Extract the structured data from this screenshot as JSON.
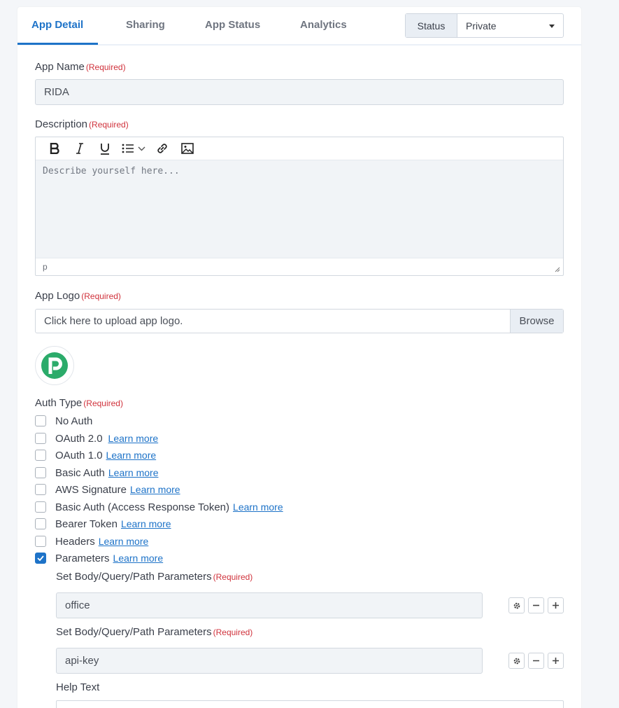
{
  "tabs": [
    {
      "label": "App Detail",
      "active": true
    },
    {
      "label": "Sharing",
      "active": false
    },
    {
      "label": "App Status",
      "active": false
    },
    {
      "label": "Analytics",
      "active": false
    }
  ],
  "status": {
    "label": "Status",
    "value": "Private"
  },
  "required_text": "(Required)",
  "app_name": {
    "label": "App Name",
    "value": "RIDA"
  },
  "description": {
    "label": "Description",
    "placeholder": "Describe yourself here...",
    "status_path": "p"
  },
  "app_logo": {
    "label": "App Logo",
    "placeholder": "Click here to upload app logo.",
    "browse_label": "Browse"
  },
  "auth_type": {
    "label": "Auth Type",
    "learn_more": "Learn more",
    "options": [
      {
        "label": "No Auth",
        "checked": false,
        "has_link": false
      },
      {
        "label": "OAuth 2.0",
        "checked": false,
        "has_link": true
      },
      {
        "label": "OAuth 1.0",
        "checked": false,
        "has_link": true
      },
      {
        "label": "Basic Auth",
        "checked": false,
        "has_link": true
      },
      {
        "label": "AWS Signature",
        "checked": false,
        "has_link": true
      },
      {
        "label": "Basic Auth (Access Response Token)",
        "checked": false,
        "has_link": true
      },
      {
        "label": "Bearer Token",
        "checked": false,
        "has_link": true
      },
      {
        "label": "Headers",
        "checked": false,
        "has_link": true
      },
      {
        "label": "Parameters",
        "checked": true,
        "has_link": true
      }
    ]
  },
  "parameters": [
    {
      "label": "Set Body/Query/Path Parameters",
      "value": "office"
    },
    {
      "label": "Set Body/Query/Path Parameters",
      "value": "api-key"
    }
  ],
  "help_text": {
    "label": "Help Text"
  },
  "colors": {
    "accent": "#1e73c8",
    "required": "#d0323c",
    "logo_green": "#2bab6a"
  },
  "icons": [
    "bold-icon",
    "italic-icon",
    "underline-icon",
    "list-icon",
    "chevron-down-icon",
    "link-icon",
    "image-icon",
    "gear-icon",
    "minus-icon",
    "plus-icon",
    "caret-down-icon",
    "resize-handle-icon",
    "check-icon"
  ]
}
